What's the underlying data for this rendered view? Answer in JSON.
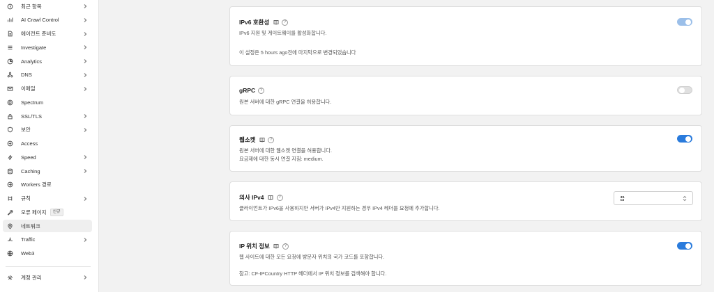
{
  "sidebar": {
    "items": [
      {
        "label": "최근 항목",
        "icon": "clock-icon",
        "chevron": true
      },
      {
        "label": "AI Crawl Control",
        "icon": "bar-chart-icon",
        "chevron": true
      },
      {
        "label": "에이전트 준비도",
        "icon": "document-icon",
        "chevron": true
      },
      {
        "label": "Investigate",
        "icon": "list-icon",
        "chevron": true
      },
      {
        "label": "Analytics",
        "icon": "pie-chart-icon",
        "chevron": true
      },
      {
        "label": "DNS",
        "icon": "network-icon",
        "chevron": true
      },
      {
        "label": "이메일",
        "icon": "mail-icon",
        "chevron": true
      },
      {
        "label": "Spectrum",
        "icon": "target-icon",
        "chevron": false
      },
      {
        "label": "SSL/TLS",
        "icon": "lock-icon",
        "chevron": true
      },
      {
        "label": "보안",
        "icon": "shield-icon",
        "chevron": true
      },
      {
        "label": "Access",
        "icon": "access-icon",
        "chevron": false
      },
      {
        "label": "Speed",
        "icon": "bolt-icon",
        "chevron": true
      },
      {
        "label": "Caching",
        "icon": "database-icon",
        "chevron": true
      },
      {
        "label": "Workers 경로",
        "icon": "workers-icon",
        "chevron": false
      },
      {
        "label": "규칙",
        "icon": "rules-icon",
        "chevron": true
      },
      {
        "label": "오류 페이지",
        "icon": "wrench-icon",
        "chevron": false,
        "badge": "신규"
      },
      {
        "label": "네트워크",
        "icon": "location-pin-icon",
        "chevron": false,
        "active": true
      },
      {
        "label": "Traffic",
        "icon": "traffic-icon",
        "chevron": true
      },
      {
        "label": "Web3",
        "icon": "globe-icon",
        "chevron": false
      }
    ],
    "footer": {
      "label": "계정 관리",
      "icon": "gear-icon",
      "chevron": true
    }
  },
  "cards": [
    {
      "title": "IPv6 호환성",
      "has_doc_icon": true,
      "desc_lines": [
        "IPv6 지원 및 게이트웨이를 활성화합니다.",
        "",
        "이 설정은 5 hours ago전에 마지막으로 변경되었습니다"
      ],
      "control": "toggle",
      "state": "on-muted"
    },
    {
      "title": "gRPC",
      "has_doc_icon": false,
      "desc_lines": [
        "원본 서버에 대한 gRPC 연결을 허용합니다."
      ],
      "control": "toggle",
      "state": "off"
    },
    {
      "title": "웹소켓",
      "has_doc_icon": true,
      "desc_lines": [
        "원본 서버에 대한 웹소켓 연결을 허용합니다.",
        "요금제에 대한 동시 연결 지침: medium."
      ],
      "control": "toggle",
      "state": "on"
    },
    {
      "title": "의사 IPv4",
      "has_doc_icon": true,
      "desc_lines": [
        "클라이언트가 IPv6을 사용하지만 서버가 IPv4만 지원하는 경우 IPv4 헤더를 요청에 추가합니다."
      ],
      "control": "select",
      "select_value": "끔"
    },
    {
      "title": "IP 위치 정보",
      "has_doc_icon": true,
      "desc_lines": [
        "웹 사이트에 대한 모든 요청에 방문자 위치의 국가 코드를 포함합니다.",
        "",
        "참고: CF-IPCountry HTTP 헤더에서 IP 위치 정보를 검색해야 합니다."
      ],
      "control": "toggle",
      "state": "on"
    }
  ],
  "colors": {
    "accent": "#2a7bdc",
    "accent_muted": "#9bbfe9",
    "page_bg": "#f2f2f2"
  }
}
